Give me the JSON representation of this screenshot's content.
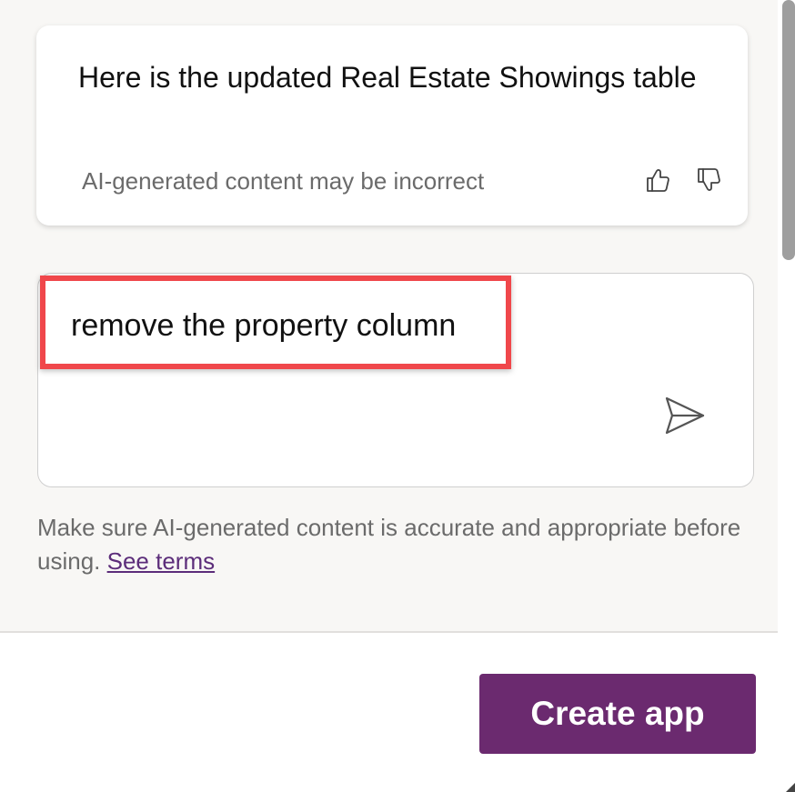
{
  "response_card": {
    "message": "Here is the updated Real Estate Showings table",
    "ai_disclaimer": "AI-generated content may be incorrect",
    "thumbs_up_icon": "thumbs-up-icon",
    "thumbs_down_icon": "thumbs-down-icon"
  },
  "prompt": {
    "value": "remove the property column",
    "send_icon": "send-icon"
  },
  "footer": {
    "note": "Make sure AI-generated content is accurate and appropriate before using.",
    "terms_link": "See terms"
  },
  "actions": {
    "create_app_label": "Create app"
  },
  "colors": {
    "accent": "#6b2a6f",
    "highlight": "#f0474b",
    "link": "#5c2d7a",
    "muted_text": "#6b6b6b"
  }
}
